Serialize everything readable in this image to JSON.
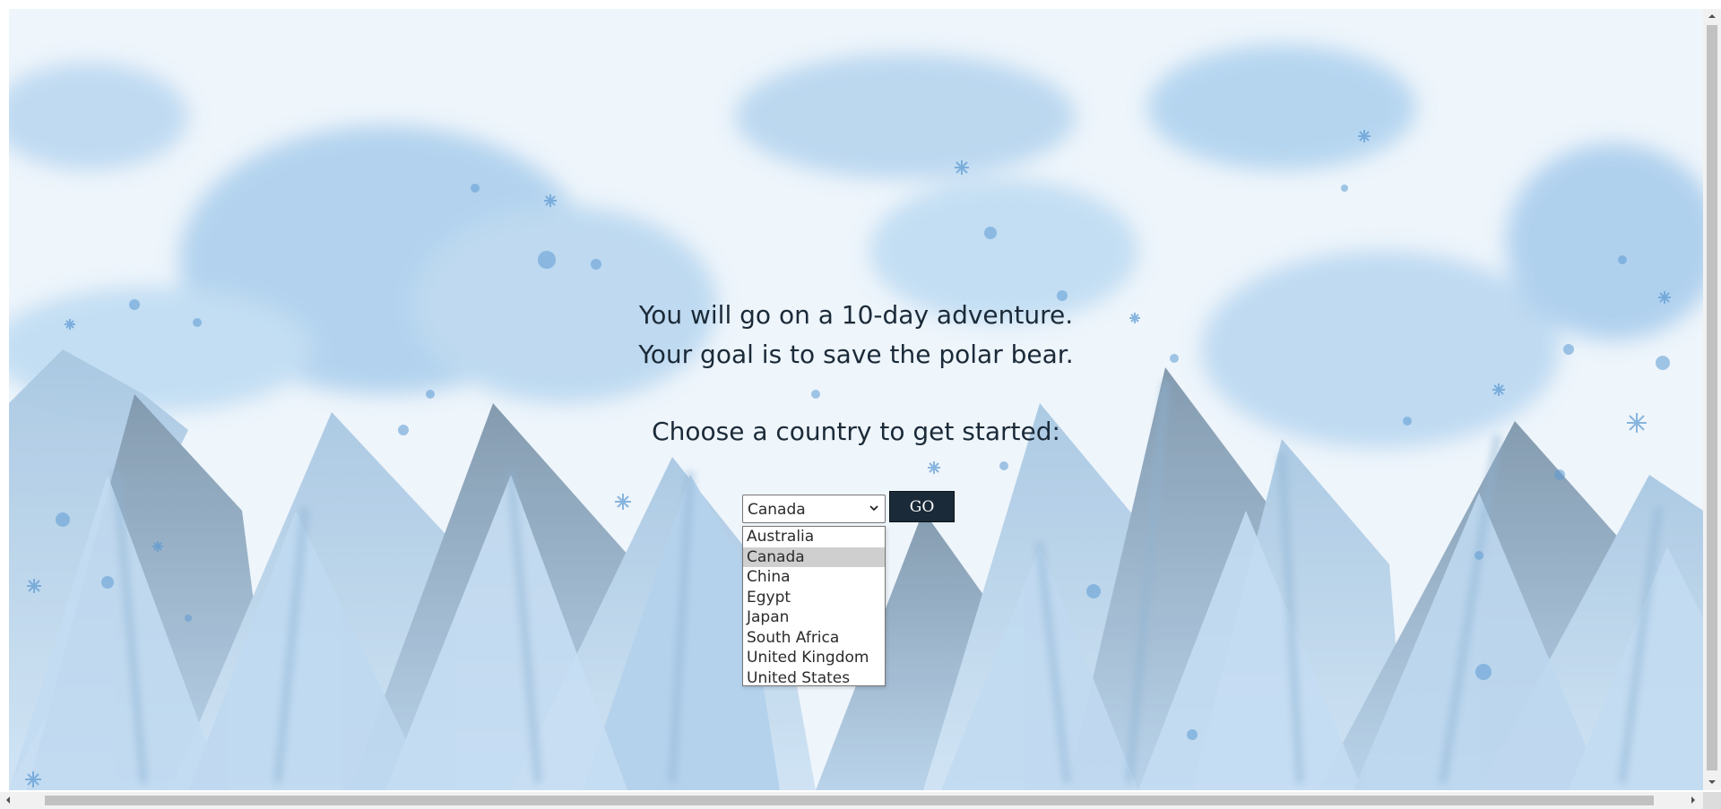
{
  "intro": {
    "line1": "You will go on a 10-day adventure.",
    "line2": "Your goal is to save the polar bear.",
    "line3": "Choose a country to get started:"
  },
  "country_select": {
    "selected": "Canada",
    "options": [
      "Australia",
      "Canada",
      "China",
      "Egypt",
      "Japan",
      "South Africa",
      "United Kingdom",
      "United States"
    ]
  },
  "go_button": {
    "label": "GO"
  },
  "colors": {
    "text": "#1b2a38",
    "button_bg": "#1b2a38",
    "button_text": "#ffffff",
    "sky": "#eef5fb",
    "mountain_light": "#b9d6ee",
    "mountain_dark": "#5a6e80"
  },
  "background": {
    "icon": "watercolor-mountains-snow-illustration"
  }
}
